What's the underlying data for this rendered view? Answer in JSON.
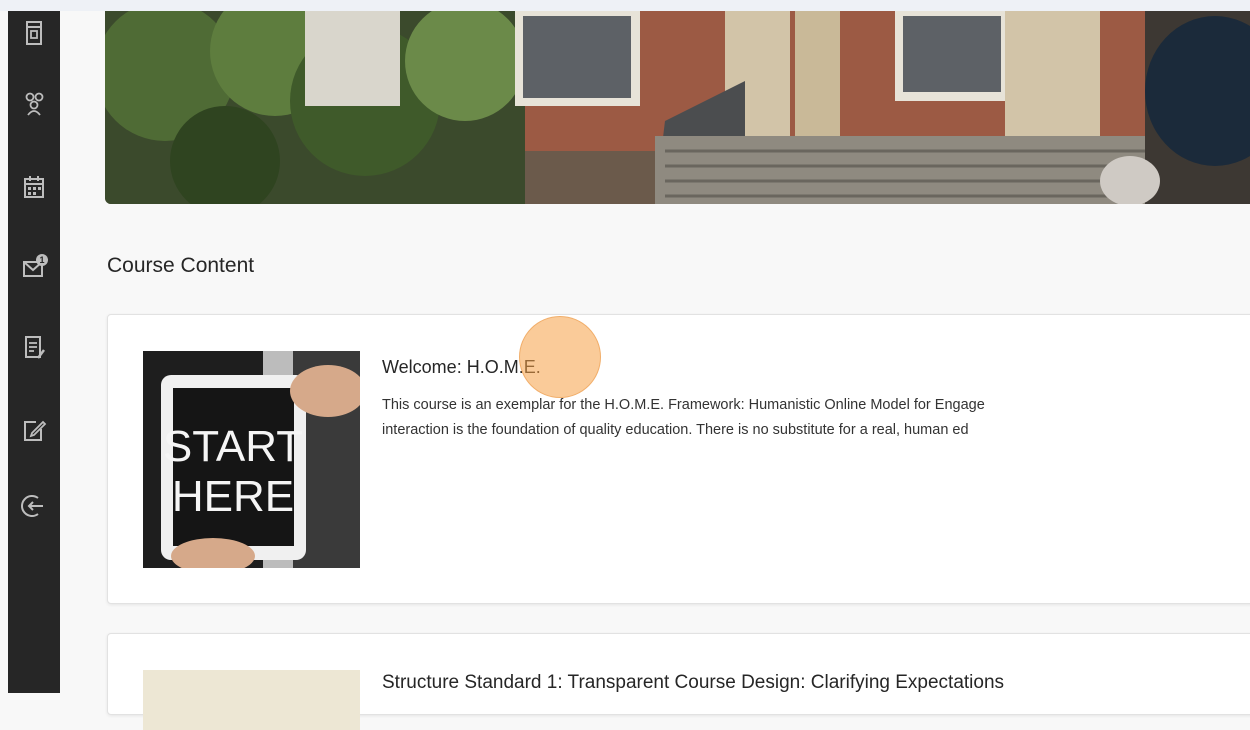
{
  "sidebar": {
    "items": [
      {
        "icon": "course-outline-icon"
      },
      {
        "icon": "roster-icon"
      },
      {
        "icon": "calendar-icon"
      },
      {
        "icon": "messages-icon",
        "badge": "1"
      },
      {
        "icon": "gradebook-icon"
      },
      {
        "icon": "edit-icon"
      },
      {
        "icon": "sign-out-icon"
      }
    ]
  },
  "banner": {
    "image": "campus-building-photo"
  },
  "content": {
    "section_title": "Course Content",
    "items": [
      {
        "title": "Welcome: H.O.M.E.",
        "description_line1": "This course is an exemplar for the H.O.M.E. Framework: Humanistic Online Model for Engage",
        "description_line2": "interaction is the foundation of quality education. There is no substitute for a real, human ed",
        "thumbnail_text_1": "START",
        "thumbnail_text_2": "HERE"
      },
      {
        "title": "Structure Standard 1: Transparent Course Design: Clarifying Expectations"
      }
    ]
  },
  "colors": {
    "sidebar_bg": "#262626",
    "page_bg": "#f8f8f8",
    "click_indicator": "#f5a046"
  }
}
